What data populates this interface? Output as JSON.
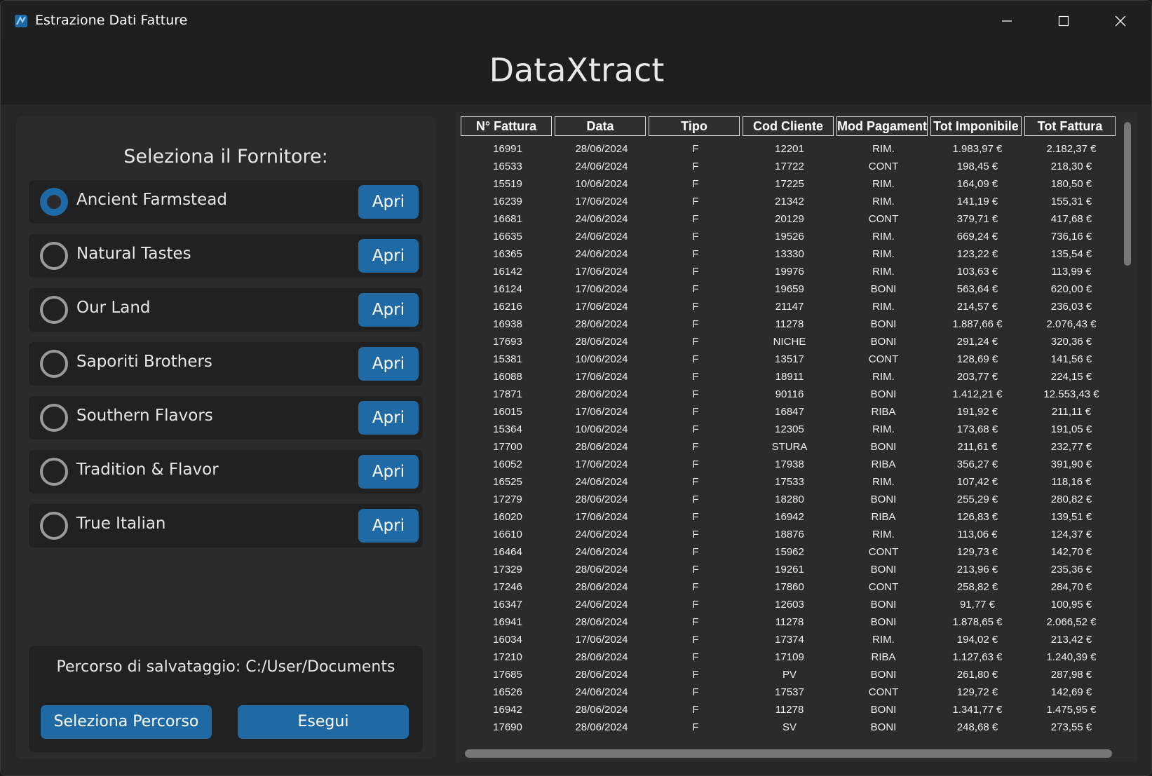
{
  "window": {
    "title": "Estrazione Dati Fatture"
  },
  "header": {
    "app_title": "DataXtract"
  },
  "left": {
    "heading": "Seleziona il Fornitore:",
    "suppliers": [
      {
        "name": "Ancient Farmstead",
        "button": "Apri",
        "selected": true
      },
      {
        "name": "Natural Tastes",
        "button": "Apri",
        "selected": false
      },
      {
        "name": "Our Land",
        "button": "Apri",
        "selected": false
      },
      {
        "name": "Saporiti Brothers",
        "button": "Apri",
        "selected": false
      },
      {
        "name": "Southern Flavors",
        "button": "Apri",
        "selected": false
      },
      {
        "name": "Tradition & Flavor",
        "button": "Apri",
        "selected": false
      },
      {
        "name": "True Italian",
        "button": "Apri",
        "selected": false
      }
    ],
    "save_path_label": "Percorso di salvataggio: C:/User/Documents",
    "select_path_button": "Seleziona Percorso",
    "run_button": "Esegui"
  },
  "table": {
    "headers": [
      "N° Fattura",
      "Data",
      "Tipo",
      "Cod Cliente",
      "Mod Pagamento",
      "Tot Imponibile",
      "Tot Fattura"
    ],
    "rows": [
      [
        "16991",
        "28/06/2024",
        "F",
        "12201",
        "RIM.",
        "1.983,97 €",
        "2.182,37 €"
      ],
      [
        "16533",
        "24/06/2024",
        "F",
        "17722",
        "CONT",
        "198,45 €",
        "218,30 €"
      ],
      [
        "15519",
        "10/06/2024",
        "F",
        "17225",
        "RIM.",
        "164,09 €",
        "180,50 €"
      ],
      [
        "16239",
        "17/06/2024",
        "F",
        "21342",
        "RIM.",
        "141,19 €",
        "155,31 €"
      ],
      [
        "16681",
        "24/06/2024",
        "F",
        "20129",
        "CONT",
        "379,71 €",
        "417,68 €"
      ],
      [
        "16635",
        "24/06/2024",
        "F",
        "19526",
        "RIM.",
        "669,24 €",
        "736,16 €"
      ],
      [
        "16365",
        "24/06/2024",
        "F",
        "13330",
        "RIM.",
        "123,22 €",
        "135,54 €"
      ],
      [
        "16142",
        "17/06/2024",
        "F",
        "19976",
        "RIM.",
        "103,63 €",
        "113,99 €"
      ],
      [
        "16124",
        "17/06/2024",
        "F",
        "19659",
        "BONI",
        "563,64 €",
        "620,00 €"
      ],
      [
        "16216",
        "17/06/2024",
        "F",
        "21147",
        "RIM.",
        "214,57 €",
        "236,03 €"
      ],
      [
        "16938",
        "28/06/2024",
        "F",
        "11278",
        "BONI",
        "1.887,66 €",
        "2.076,43 €"
      ],
      [
        "17693",
        "28/06/2024",
        "F",
        "NICHE",
        "BONI",
        "291,24 €",
        "320,36 €"
      ],
      [
        "15381",
        "10/06/2024",
        "F",
        "13517",
        "CONT",
        "128,69 €",
        "141,56 €"
      ],
      [
        "16088",
        "17/06/2024",
        "F",
        "18911",
        "RIM.",
        "203,77 €",
        "224,15 €"
      ],
      [
        "17871",
        "28/06/2024",
        "F",
        "90116",
        "BONI",
        "1.412,21 €",
        "12.553,43 €"
      ],
      [
        "16015",
        "17/06/2024",
        "F",
        "16847",
        "RIBA",
        "191,92 €",
        "211,11 €"
      ],
      [
        "15364",
        "10/06/2024",
        "F",
        "12305",
        "RIM.",
        "173,68 €",
        "191,05 €"
      ],
      [
        "17700",
        "28/06/2024",
        "F",
        "STURA",
        "BONI",
        "211,61 €",
        "232,77 €"
      ],
      [
        "16052",
        "17/06/2024",
        "F",
        "17938",
        "RIBA",
        "356,27 €",
        "391,90 €"
      ],
      [
        "16525",
        "24/06/2024",
        "F",
        "17533",
        "RIM.",
        "107,42 €",
        "118,16 €"
      ],
      [
        "17279",
        "28/06/2024",
        "F",
        "18280",
        "BONI",
        "255,29 €",
        "280,82 €"
      ],
      [
        "16020",
        "17/06/2024",
        "F",
        "16942",
        "RIBA",
        "126,83 €",
        "139,51 €"
      ],
      [
        "16610",
        "24/06/2024",
        "F",
        "18876",
        "RIM.",
        "113,06 €",
        "124,37 €"
      ],
      [
        "16464",
        "24/06/2024",
        "F",
        "15962",
        "CONT",
        "129,73 €",
        "142,70 €"
      ],
      [
        "17329",
        "28/06/2024",
        "F",
        "19261",
        "BONI",
        "213,96 €",
        "235,36 €"
      ],
      [
        "17246",
        "28/06/2024",
        "F",
        "17860",
        "CONT",
        "258,82 €",
        "284,70 €"
      ],
      [
        "16347",
        "24/06/2024",
        "F",
        "12603",
        "BONI",
        "91,77 €",
        "100,95 €"
      ],
      [
        "16941",
        "28/06/2024",
        "F",
        "11278",
        "BONI",
        "1.878,65 €",
        "2.066,52 €"
      ],
      [
        "16034",
        "17/06/2024",
        "F",
        "17374",
        "RIM.",
        "194,02 €",
        "213,42 €"
      ],
      [
        "17210",
        "28/06/2024",
        "F",
        "17109",
        "RIBA",
        "1.127,63 €",
        "1.240,39 €"
      ],
      [
        "17685",
        "28/06/2024",
        "F",
        "PV",
        "BONI",
        "261,80 €",
        "287,98 €"
      ],
      [
        "16526",
        "24/06/2024",
        "F",
        "17537",
        "CONT",
        "129,72 €",
        "142,69 €"
      ],
      [
        "16942",
        "28/06/2024",
        "F",
        "11278",
        "BONI",
        "1.341,77 €",
        "1.475,95 €"
      ],
      [
        "17690",
        "28/06/2024",
        "F",
        "SV",
        "BONI",
        "248,68 €",
        "273,55 €"
      ]
    ]
  },
  "colors": {
    "accent": "#1f6aa5",
    "window_bg": "#1e1e1e",
    "panel_bg": "#2b2b2b",
    "row_bg": "#212121"
  },
  "icons": {
    "app": "app-logo-icon",
    "minimize": "minimize-icon",
    "maximize": "maximize-icon",
    "close": "close-icon"
  }
}
